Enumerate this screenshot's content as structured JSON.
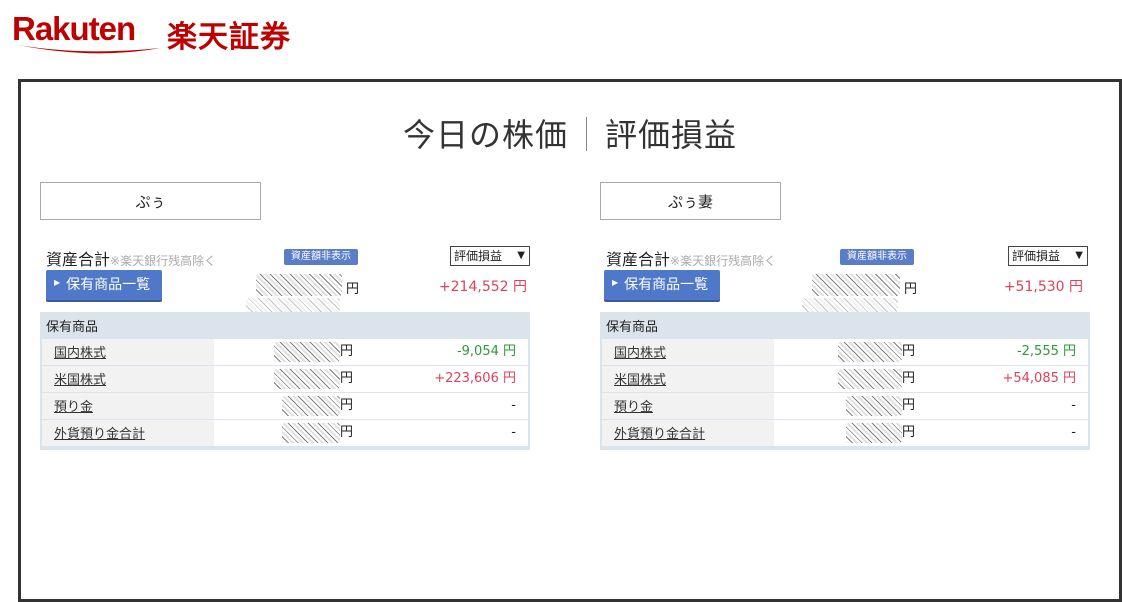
{
  "logo": {
    "latin": "Rakuten",
    "japanese": "楽天証券",
    "color": "#bf0000"
  },
  "title": {
    "left": "今日の株価",
    "right": "評価損益"
  },
  "accounts": [
    {
      "name": "ぷぅ",
      "asset_label": "資産合計",
      "asset_note": "※楽天銀行残高除く",
      "hide_badge": "資産額非表示",
      "select_value": "評価損益",
      "list_button": "保有商品一覧",
      "total_unit": "円",
      "total_pl": "+214,552 円",
      "holdings_header": "保有商品",
      "rows": [
        {
          "name": "国内株式",
          "unit": "円",
          "pl": "-9,054 円",
          "pl_type": "neg"
        },
        {
          "name": "米国株式",
          "unit": "円",
          "pl": "+223,606 円",
          "pl_type": "pos"
        },
        {
          "name": "預り金",
          "unit": "円",
          "pl": "-",
          "pl_type": "none"
        },
        {
          "name": "外貨預り金合計",
          "unit": "円",
          "pl": "-",
          "pl_type": "none"
        }
      ]
    },
    {
      "name": "ぷぅ妻",
      "asset_label": "資産合計",
      "asset_note": "※楽天銀行残高除く",
      "hide_badge": "資産額非表示",
      "select_value": "評価損益",
      "list_button": "保有商品一覧",
      "total_unit": "円",
      "total_pl": "+51,530 円",
      "holdings_header": "保有商品",
      "rows": [
        {
          "name": "国内株式",
          "unit": "円",
          "pl": "-2,555 円",
          "pl_type": "neg"
        },
        {
          "name": "米国株式",
          "unit": "円",
          "pl": "+54,085 円",
          "pl_type": "pos"
        },
        {
          "name": "預り金",
          "unit": "円",
          "pl": "-",
          "pl_type": "none"
        },
        {
          "name": "外貨預り金合計",
          "unit": "円",
          "pl": "-",
          "pl_type": "none"
        }
      ]
    }
  ],
  "colors": {
    "positive": "#e0405a",
    "negative": "#2a9a3a",
    "button": "#4f78c8",
    "badge": "#5b7dc8"
  }
}
